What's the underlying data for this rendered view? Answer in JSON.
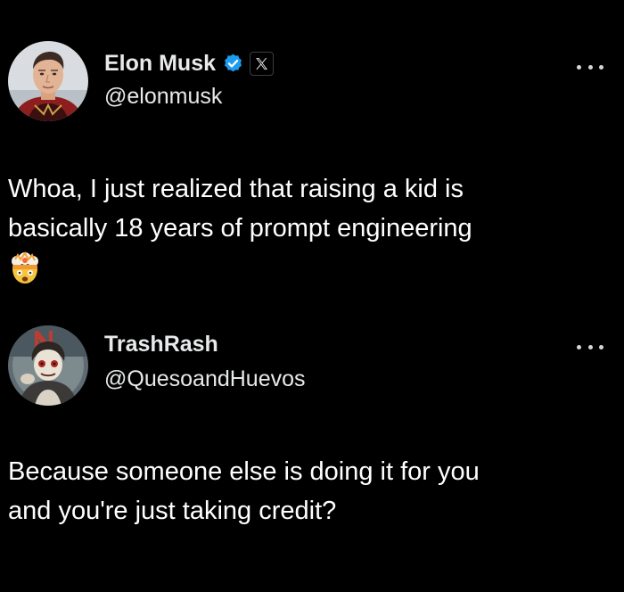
{
  "posts": [
    {
      "author": {
        "display_name": "Elon Musk",
        "handle": "@elonmusk",
        "verified": true,
        "affiliate_badge": "x-logo-icon",
        "avatar": "avatar-elon"
      },
      "text_lines": [
        "Whoa, I just realized that raising a kid is",
        "basically 18 years of prompt engineering"
      ],
      "emoji": "exploding-head-icon",
      "more_icon": "more-horizontal-icon"
    },
    {
      "author": {
        "display_name": "TrashRash",
        "handle": "@QuesoandHuevos",
        "avatar": "avatar-trashrash"
      },
      "text_lines": [
        "Because someone else is doing it for you",
        "and you're just taking credit?"
      ],
      "more_icon": "more-horizontal-icon"
    }
  ],
  "colors": {
    "background": "#000000",
    "text": "#ffffff",
    "verified_badge": "#1d9bf0"
  }
}
